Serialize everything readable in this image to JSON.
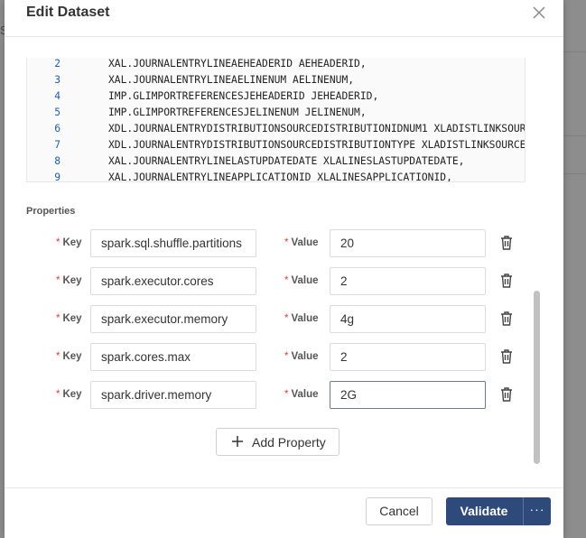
{
  "background": {
    "left_fragment": "S"
  },
  "dialog": {
    "title": "Edit Dataset",
    "close_icon": "close-icon"
  },
  "code": {
    "lines": [
      {
        "num": "2",
        "text": "XAL.JOURNALENTRYLINEAEHEADERID AEHEADERID,"
      },
      {
        "num": "3",
        "text": "XAL.JOURNALENTRYLINEAELINENUM AELINENUM,"
      },
      {
        "num": "4",
        "text": "IMP.GLIMPORTREFERENCESJEHEADERID JEHEADERID,"
      },
      {
        "num": "5",
        "text": "IMP.GLIMPORTREFERENCESJELINENUM JELINENUM,"
      },
      {
        "num": "6",
        "text": "XDL.JOURNALENTRYDISTRIBUTIONSOURCEDISTRIBUTIONIDNUM1 XLADISTLINKSOUR"
      },
      {
        "num": "7",
        "text": "XDL.JOURNALENTRYDISTRIBUTIONSOURCEDISTRIBUTIONTYPE XLADISTLINKSOURCE"
      },
      {
        "num": "8",
        "text": "XAL.JOURNALENTRYLINELASTUPDATEDATE XLALINESLASTUPDATEDATE,"
      },
      {
        "num": "9",
        "text": "XAL.JOURNALENTRYLINEAPPLICATIONID XLALINESAPPLICATIONID,"
      }
    ]
  },
  "properties": {
    "section_label": "Properties",
    "required_mark": "*",
    "key_label": "Key",
    "value_label": "Value",
    "rows": [
      {
        "key": "spark.sql.shuffle.partitions",
        "value": "20"
      },
      {
        "key": "spark.executor.cores",
        "value": "2"
      },
      {
        "key": "spark.executor.memory",
        "value": "4g"
      },
      {
        "key": "spark.cores.max",
        "value": "2"
      },
      {
        "key": "spark.driver.memory",
        "value": "2G"
      }
    ],
    "add_label": "Add Property"
  },
  "footer": {
    "cancel_label": "Cancel",
    "validate_label": "Validate",
    "more_label": "···"
  },
  "colors": {
    "primary": "#2e4a7a",
    "required": "#e23b3b",
    "line_number": "#1f5fa8"
  }
}
